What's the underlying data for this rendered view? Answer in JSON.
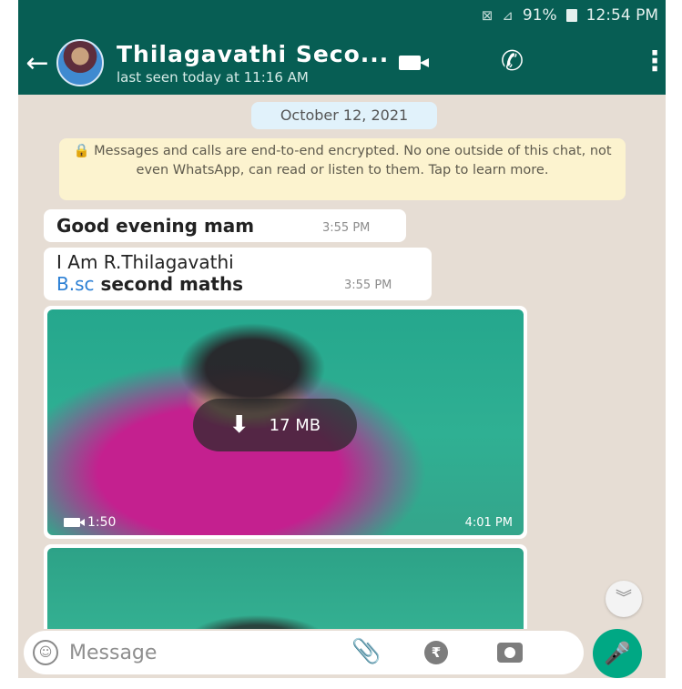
{
  "status_bar": {
    "battery_text": "91%",
    "time": "12:54 PM"
  },
  "header": {
    "contact_name": "Thilagavathi Seco...",
    "last_seen": "last seen today at 11:16 AM"
  },
  "chat": {
    "date_label": "October 12, 2021",
    "encryption_notice": "🔒 Messages and calls are end-to-end encrypted. No one outside of this chat, not even WhatsApp, can read or listen to them. Tap to learn more.",
    "messages": [
      {
        "text": "Good evening mam",
        "time": "3:55 PM"
      },
      {
        "line1": "I Am R.Thilagavathi",
        "line2_link": "B.sc",
        "line2_rest": " second maths",
        "time": "3:55 PM"
      }
    ],
    "media": {
      "size": "17 MB",
      "duration": "1:50",
      "time": "4:01 PM"
    }
  },
  "composer": {
    "placeholder": "Message"
  },
  "colors": {
    "header_bg": "#075e54",
    "chat_bg": "#e6ddd4",
    "accent_mic": "#00a884",
    "link": "#2b7fd4"
  },
  "icons": [
    "back-arrow-icon",
    "video-call-icon",
    "voice-call-icon",
    "more-options-icon",
    "emoji-icon",
    "attach-icon",
    "rupee-payment-icon",
    "camera-icon",
    "mic-icon",
    "download-icon",
    "scroll-down-icon",
    "lock-icon"
  ]
}
